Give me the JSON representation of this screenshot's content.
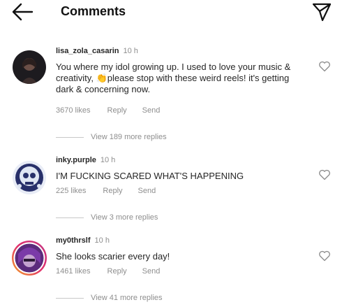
{
  "header": {
    "title": "Comments",
    "back_icon": "arrow-left-icon",
    "send_icon": "paper-plane-icon"
  },
  "comments": [
    {
      "username": "lisa_zola_casarin",
      "time": "10 h",
      "text_before": "You where my idol growing up. I used to love your music & creativity, ",
      "emoji": "👏",
      "text_after": "please stop with these weird reels! it's getting dark & concerning now.",
      "likes": "3670 likes",
      "reply_label": "Reply",
      "send_label": "Send",
      "view_replies": "View 189 more replies"
    },
    {
      "username": "inky.purple",
      "time": "10 h",
      "text": "I'M FUCKING SCARED WHAT'S HAPPENING",
      "likes": "225 likes",
      "reply_label": "Reply",
      "send_label": "Send",
      "view_replies": "View 3 more replies"
    },
    {
      "username": "my0thrslf",
      "time": "10 h",
      "text": "She looks scarier every day!",
      "likes": "1461 likes",
      "reply_label": "Reply",
      "send_label": "Send",
      "view_replies": "View 41 more replies"
    }
  ],
  "colors": {
    "text": "#262626",
    "muted": "#8e8e8e",
    "story_ring_start": "#f5a623",
    "story_ring_end": "#c13584"
  }
}
